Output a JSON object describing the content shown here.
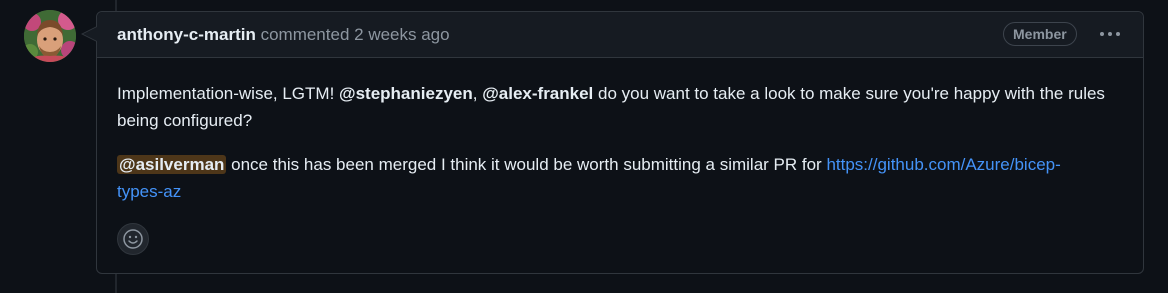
{
  "comment": {
    "author": "anthony-c-martin",
    "action": "commented",
    "time": "2 weeks ago",
    "badge": "Member",
    "paragraph1": {
      "text1": "Implementation-wise, LGTM! ",
      "mention1": "@stephaniezyen",
      "sep": ", ",
      "mention2": "@alex-frankel",
      "text2": " do you want to take a look to make sure you're happy with the rules being configured?"
    },
    "paragraph2": {
      "mention": "@asilverman",
      "text": " once this has been merged I think it would be worth submitting a similar PR for ",
      "link": "https://github.com/Azure/bicep-types-az"
    }
  },
  "icons": {
    "avatar": "user-avatar",
    "menu": "kebab-horizontal-icon",
    "reaction": "smiley-icon"
  },
  "colors": {
    "background": "#0d1117",
    "header": "#161b22",
    "border": "#30363d",
    "link": "#4493f8",
    "mention_highlight": "#4d3619",
    "muted": "#8d96a0"
  }
}
